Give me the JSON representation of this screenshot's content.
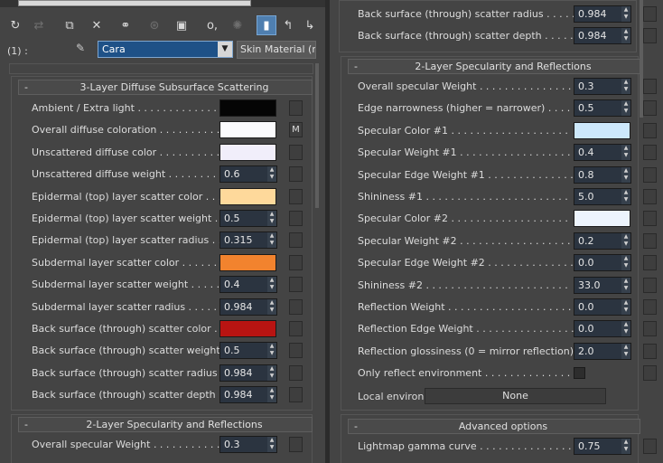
{
  "material": {
    "id_label": "(1) :",
    "name": "Cara",
    "type_button": "Skin Material (mi)"
  },
  "toolbar": {
    "icons": [
      "get-material-icon",
      "put-to-scene-icon",
      "assign-material-icon",
      "reset-icon",
      "make-copy-icon",
      "make-unique-icon",
      "put-to-library-icon",
      "material-id-icon",
      "show-map-icon",
      "show-end-result-icon",
      "go-to-parent-icon",
      "go-forward-icon"
    ]
  },
  "left": {
    "section1": {
      "title": "3-Layer Diffuse Subsurface Scattering",
      "toggle": "-"
    },
    "rows": [
      {
        "label": "Ambient / Extra light . . . . . . . . . . . . . . . .",
        "kind": "color",
        "color": "#050505"
      },
      {
        "label": "Overall diffuse coloration . . . . . . . . . . . . .",
        "kind": "color",
        "color": "#fbfbfd",
        "map": "M"
      },
      {
        "label": "Unscattered diffuse color . . . . . . . . . . . . .",
        "kind": "color",
        "color": "#f1eefa"
      },
      {
        "label": "Unscattered diffuse weight . . . . . . . . . . . .",
        "kind": "value",
        "value": "0.6"
      },
      {
        "label": "Epidermal (top) layer scatter color . . . . . . .",
        "kind": "color",
        "color": "#fed99b"
      },
      {
        "label": "Epidermal (top) layer scatter weight . . . . . . .",
        "kind": "value",
        "value": "0.5"
      },
      {
        "label": "Epidermal (top) layer scatter radius . . . . . . .",
        "kind": "value",
        "value": "0.315"
      },
      {
        "label": "Subdermal layer scatter color . . . . . . . . . .",
        "kind": "color",
        "color": "#f2832e"
      },
      {
        "label": "Subdermal layer scatter weight . . . . . . . . . .",
        "kind": "value",
        "value": "0.4"
      },
      {
        "label": "Subdermal layer scatter radius . . . . . . . . . .",
        "kind": "value",
        "value": "0.984"
      },
      {
        "label": "Back surface (through) scatter color . . . . . . .",
        "kind": "color",
        "color": "#b81412"
      },
      {
        "label": "Back surface (through) scatter weight . . . . . .",
        "kind": "value",
        "value": "0.5"
      },
      {
        "label": "Back surface (through) scatter radius . . . . .",
        "kind": "value",
        "value": "0.984"
      },
      {
        "label": "Back surface (through) scatter depth . . . . . .",
        "kind": "value",
        "value": "0.984"
      }
    ],
    "section2": {
      "title": "2-Layer Specularity and Reflections",
      "toggle": "-"
    },
    "section2_rows": [
      {
        "label": "Overall specular Weight . . . . . . . . . . . . . . .",
        "kind": "value",
        "value": "0.3"
      }
    ]
  },
  "right": {
    "top_rows": [
      {
        "label": "Back surface (through) scatter radius . . . . .",
        "kind": "value",
        "value": "0.984"
      },
      {
        "label": "Back surface (through) scatter depth . . . . . .",
        "kind": "value",
        "value": "0.984"
      }
    ],
    "section1": {
      "title": "2-Layer Specularity and Reflections",
      "toggle": "-"
    },
    "rows": [
      {
        "label": "Overall specular Weight . . . . . . . . . . . . . . .",
        "kind": "value",
        "value": "0.3"
      },
      {
        "label": "Edge narrowness (higher = narrower) . . . . . .",
        "kind": "value",
        "value": "0.5"
      },
      {
        "label": "Specular Color #1 . . . . . . . . . . . . . . . . . . .",
        "kind": "color",
        "color": "#cde8fb"
      },
      {
        "label": "Specular Weight #1 . . . . . . . . . . . . . . . . . .",
        "kind": "value",
        "value": "0.4"
      },
      {
        "label": "Specular Edge Weight #1 . . . . . . . . . . . . . .",
        "kind": "value",
        "value": "0.8"
      },
      {
        "label": "Shininess #1 . . . . . . . . . . . . . . . . . . . . . . .",
        "kind": "value",
        "value": "5.0"
      },
      {
        "label": "Specular Color #2 . . . . . . . . . . . . . . . . . . .",
        "kind": "color",
        "color": "#edf4fd"
      },
      {
        "label": "Specular Weight #2 . . . . . . . . . . . . . . . . . .",
        "kind": "value",
        "value": "0.2"
      },
      {
        "label": "Specular Edge Weight #2 . . . . . . . . . . . . . .",
        "kind": "value",
        "value": "0.0"
      },
      {
        "label": "Shininess #2 . . . . . . . . . . . . . . . . . . . . . . .",
        "kind": "value",
        "value": "33.0"
      },
      {
        "label": "Reflection Weight . . . . . . . . . . . . . . . . . . . .",
        "kind": "value",
        "value": "0.0"
      },
      {
        "label": "Reflection Edge Weight . . . . . . . . . . . . . . . .",
        "kind": "value",
        "value": "0.0"
      },
      {
        "label": "Reflection glossiness (0 = mirror reflection) . .",
        "kind": "value",
        "value": "2.0"
      },
      {
        "label": "Only reflect environment . . . . . . . . . . . . . .",
        "kind": "check"
      }
    ],
    "local_env": {
      "label": "Local environ...",
      "button": "None"
    },
    "section2": {
      "title": "Advanced options",
      "toggle": "-"
    },
    "section2_rows": [
      {
        "label": "Lightmap gamma curve . . . . . . . . . . . . . . . .",
        "kind": "value",
        "value": "0.75"
      }
    ]
  }
}
